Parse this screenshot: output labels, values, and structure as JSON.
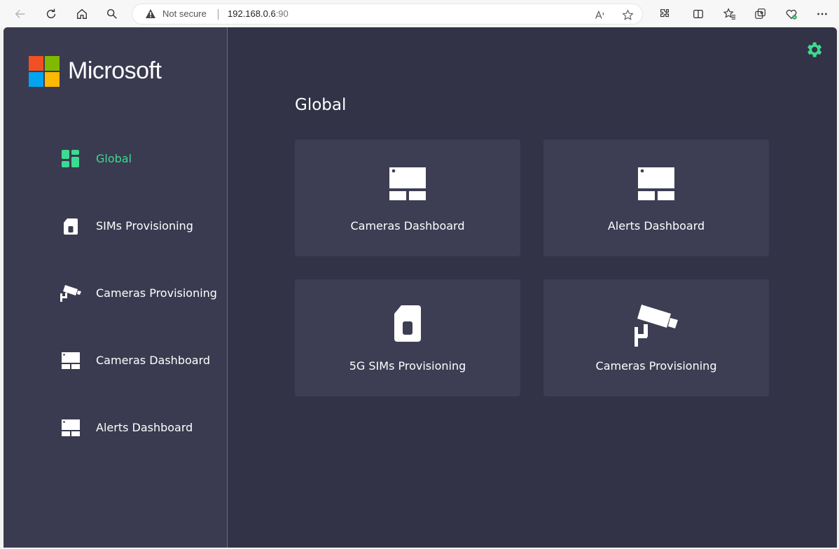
{
  "browser": {
    "security_label": "Not secure",
    "url_host": "192.168.0.6",
    "url_port": ":90"
  },
  "app": {
    "brand": "Microsoft",
    "logo_colors": [
      "#f25022",
      "#7fba00",
      "#00a4ef",
      "#ffb900"
    ],
    "accent_color": "#3ddb8f",
    "page_title": "Global",
    "sidebar": {
      "items": [
        {
          "label": "Global",
          "icon": "dashboard-grid-icon",
          "active": true
        },
        {
          "label": "SIMs Provisioning",
          "icon": "sim-card-icon",
          "active": false
        },
        {
          "label": "Cameras Provisioning",
          "icon": "security-camera-icon",
          "active": false
        },
        {
          "label": "Cameras Dashboard",
          "icon": "dashboard-panel-icon",
          "active": false
        },
        {
          "label": "Alerts Dashboard",
          "icon": "dashboard-panel-icon",
          "active": false
        }
      ]
    },
    "cards": [
      {
        "label": "Cameras Dashboard",
        "icon": "dashboard-panel-icon"
      },
      {
        "label": "Alerts Dashboard",
        "icon": "dashboard-panel-icon"
      },
      {
        "label": "5G SIMs Provisioning",
        "icon": "sim-card-icon"
      },
      {
        "label": "Cameras Provisioning",
        "icon": "security-camera-icon"
      }
    ]
  }
}
